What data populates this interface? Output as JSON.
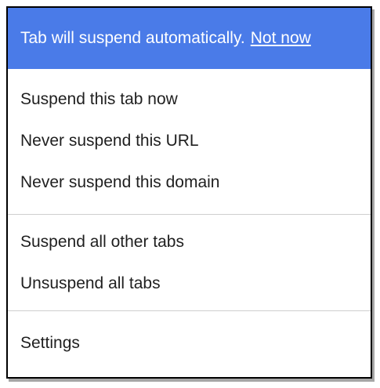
{
  "status": {
    "message": "Tab will suspend automatically.",
    "action_label": "Not now",
    "background": "#4a7be8"
  },
  "menu": {
    "group1": [
      {
        "label": "Suspend this tab now"
      },
      {
        "label": "Never suspend this URL"
      },
      {
        "label": "Never suspend this domain"
      }
    ],
    "group2": [
      {
        "label": "Suspend all other tabs"
      },
      {
        "label": "Unsuspend all tabs"
      }
    ],
    "group3": [
      {
        "label": "Settings"
      }
    ]
  }
}
